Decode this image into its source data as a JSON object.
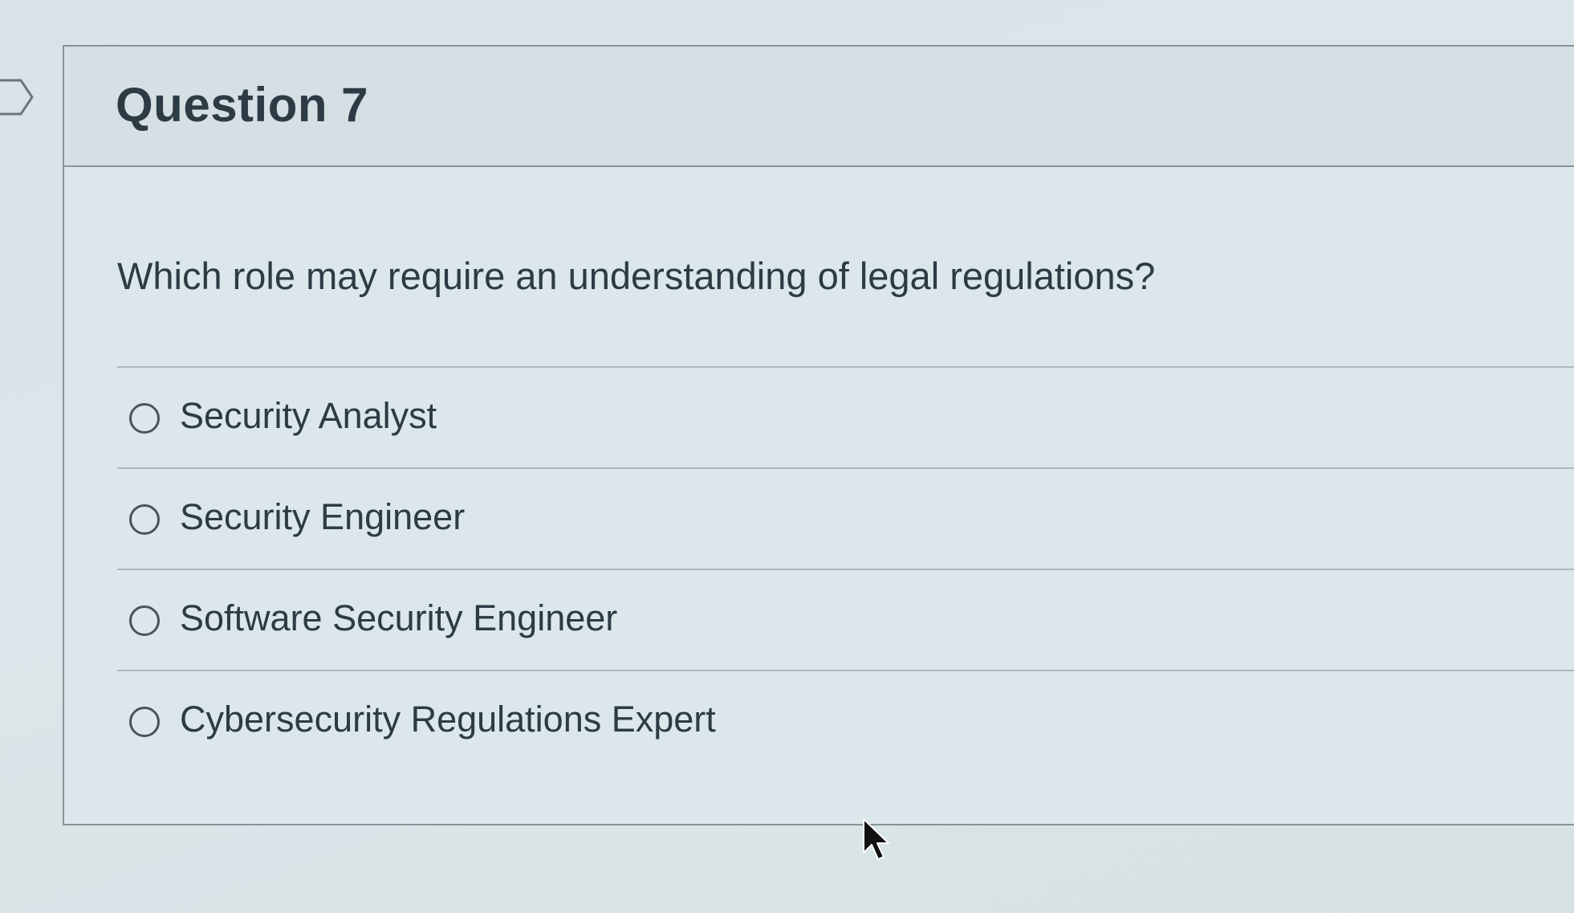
{
  "question": {
    "title": "Question 7",
    "prompt": "Which role may require an understanding of legal regulations?"
  },
  "answers": [
    {
      "label": "Security Analyst",
      "selected": false
    },
    {
      "label": "Security Engineer",
      "selected": false
    },
    {
      "label": "Software Security Engineer",
      "selected": false
    },
    {
      "label": "Cybersecurity Regulations Expert",
      "selected": false
    }
  ],
  "icons": {
    "flag": "flag-marker-icon",
    "radio": "radio-button-icon",
    "cursor": "mouse-pointer-icon"
  },
  "colors": {
    "text": "#2d3b45",
    "border": "#8a9399",
    "divider": "#aeb7bc",
    "header_bg": "#d5dfe4"
  }
}
